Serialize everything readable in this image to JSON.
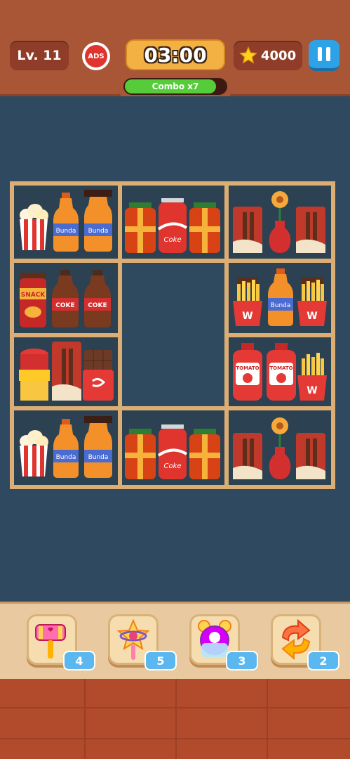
{
  "hud": {
    "level": "Lv. 11",
    "ads_label": "ADS",
    "timer": "03:00",
    "coins": "4000",
    "combo_label": "Combo x7",
    "combo_progress": 0.9
  },
  "shelves": {
    "labels": {
      "bunda": "Bunda",
      "coke": "COKE",
      "coke_can": "Coke",
      "snack": "SNACK",
      "tomato": "TOMATO",
      "w": "W"
    }
  },
  "boosters": [
    {
      "name": "hammer",
      "count": "4"
    },
    {
      "name": "magic-wand",
      "count": "5"
    },
    {
      "name": "alarm-clock",
      "count": "3"
    },
    {
      "name": "shuffle",
      "count": "2"
    }
  ],
  "colors": {
    "header": "#a85636",
    "board": "#2f4a60",
    "shelf_wood": "#dcae74",
    "timer": "#f3b143",
    "pause": "#2ea2e6",
    "combo_fill": "#56cc3a",
    "badge": "#5ab7ef"
  }
}
